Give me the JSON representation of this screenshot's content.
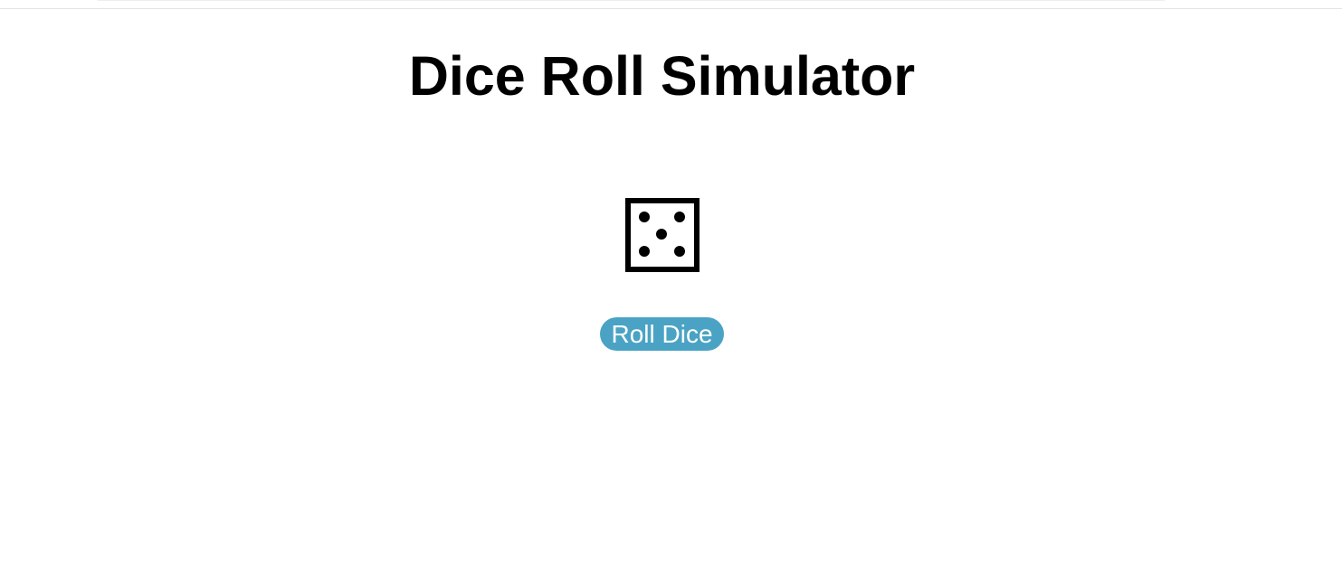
{
  "page": {
    "title": "Dice Roll Simulator"
  },
  "die": {
    "face_value": 5,
    "icon": "die-face-5-icon"
  },
  "controls": {
    "roll_button_label": "Roll Dice"
  },
  "colors": {
    "accent": "#4aa3c4",
    "text": "#000000",
    "background": "#ffffff"
  }
}
